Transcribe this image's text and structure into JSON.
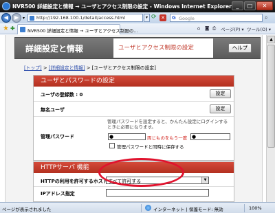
{
  "window": {
    "title": "NVR500 詳細設定と情報 → ユーザとアクセス制限の設定 - Windows Internet Explorer",
    "minimize": "_",
    "maximize": "□",
    "close": "✕"
  },
  "address": {
    "url": "http://192.168.100.1/detail/access.html",
    "search_engine": "G",
    "search_placeholder": "Google"
  },
  "tab": {
    "title": "NVR500 詳細設定と情報 → ユーザとアクセス制限の..."
  },
  "toolbar": {
    "home": "⌂",
    "rss": "◙",
    "print": "⎙",
    "page": "ページ(P) ▾",
    "tools": "ツール(O) ▾"
  },
  "header": {
    "title": "詳細設定と情報",
    "subtitle": "ユーザとアクセス制限の設定",
    "help": "ヘルプ"
  },
  "breadcrumb": {
    "top": "[トップ]",
    "sep1": " > ",
    "detail": "[詳細設定と情報]",
    "sep2": " > ",
    "current": "[ユーザとアクセス制限の設定]"
  },
  "section_users": {
    "title": "ユーザとパスワードの設定",
    "user_count_label": "ユーザの登録数 : 0",
    "anon_label": "無名ユーザ",
    "admin_pw_label": "管理パスワード",
    "set_button": "設定"
  },
  "password": {
    "hint": "管理パスワードを設定すると、かんたん設定にログインするときに必要になります。",
    "field1_value": "●",
    "field2_value": "●",
    "middle_note": "両じものをもう一度",
    "sync_checkbox_label": "管理パスワードと同時に保存する"
  },
  "section_http": {
    "title": "HTTPサーバ 機能",
    "allow_host_label": "HTTPの利用を許可するホスト",
    "allow_host_value": "すべて許可する",
    "ip_label": "IPアドレス指定"
  },
  "dropdown_options": [
    "すべて許可する"
  ],
  "status": {
    "text": "ページが表示されました",
    "zone": "インターネット | 保護モード: 無効",
    "zoom": "100%"
  },
  "colors": {
    "accent": "#c0392b",
    "header_bg": "#666666",
    "highlight": "#e0132e"
  }
}
